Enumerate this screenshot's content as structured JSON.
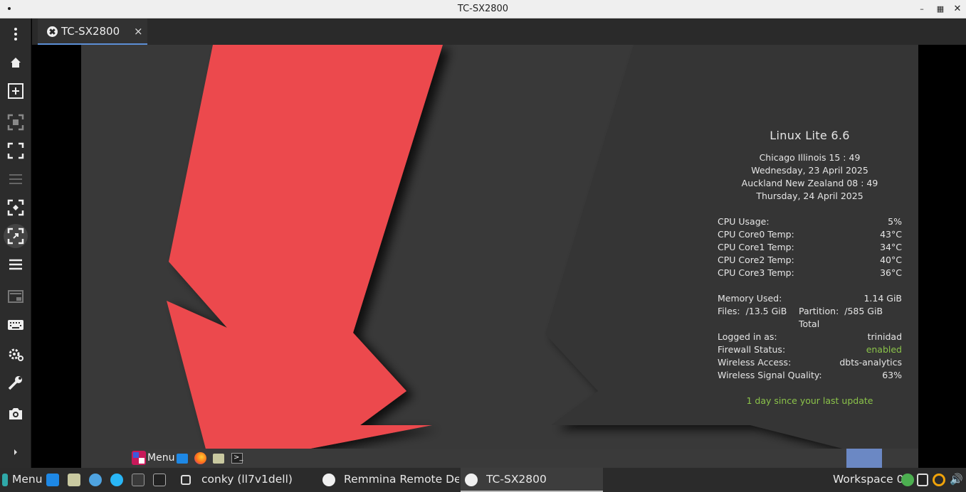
{
  "window": {
    "title": "TC-SX2800"
  },
  "tab": {
    "label": "TC-SX2800",
    "close": "×"
  },
  "sidebar": [
    "menu-dots",
    "home",
    "new-connection",
    "fit-window",
    "fullscreen",
    "list",
    "scale",
    "dynamic-resolution",
    "menu-list",
    "multi-monitor",
    "keyboard",
    "preferences",
    "tools",
    "screenshot",
    "expand"
  ],
  "conky": {
    "title": "Linux Lite 6.6",
    "city1": "Chicago Illinois 15 : 49",
    "date1": "Wednesday, 23 April 2025",
    "city2": "Auckland New Zealand  08 : 49",
    "date2": "Thursday, 24 April 2025",
    "cpu_usage_label": "CPU Usage:",
    "cpu_usage": "5%",
    "core0_label": "CPU Core0 Temp:",
    "core0": "43°C",
    "core1_label": "CPU Core1 Temp:",
    "core1": "34°C",
    "core2_label": "CPU Core2 Temp:",
    "core2": "40°C",
    "core3_label": "CPU Core3 Temp:",
    "core3": "36°C",
    "mem_label": "Memory Used:",
    "mem": "1.14 GiB",
    "files_label": "Files:",
    "files": "/13.5 GiB",
    "partition_label": "Partition:",
    "partition": "/585 GiB Total",
    "user_label": "Logged in as:",
    "user": "trinidad",
    "fw_label": "Firewall Status:",
    "fw": "enabled",
    "wifi_label": "Wireless Access:",
    "wifi": "dbts-analytics",
    "signal_label": "Wireless Signal Quality:",
    "signal": "63%",
    "update": "1 day since your last update"
  },
  "remote_taskbar": {
    "menu": "Menu"
  },
  "local_taskbar": {
    "menu": "Menu",
    "task1": "conky (ll7v1dell)",
    "task2": "Remmina Remote De...",
    "task3": "TC-SX2800",
    "workspace": "Workspace 0"
  },
  "colors": {
    "accent_red": "#ec4a4d",
    "wallpaper": "#393939",
    "tab_underline": "#5c8fd6",
    "enabled_green": "#8bc34a"
  }
}
